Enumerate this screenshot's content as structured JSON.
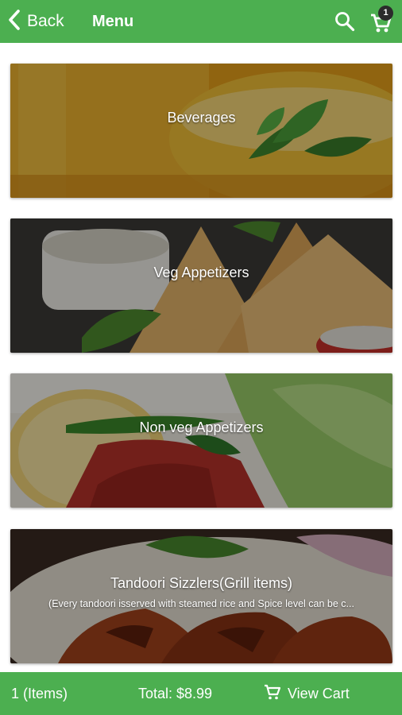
{
  "header": {
    "back_label": "Back",
    "title": "Menu",
    "cart_count": "1"
  },
  "categories": [
    {
      "label": "Beverages",
      "subtitle": ""
    },
    {
      "label": "Veg Appetizers",
      "subtitle": ""
    },
    {
      "label": "Non veg Appetizers",
      "subtitle": ""
    },
    {
      "label": "Tandoori Sizzlers(Grill items)",
      "subtitle": "(Every tandoori isserved with steamed rice and Spice level can be c..."
    }
  ],
  "footer": {
    "items": "1 (Items)",
    "total": "Total: $8.99",
    "view_cart": "View Cart"
  },
  "colors": {
    "accent": "#4caf50",
    "badge": "#2b2b2b"
  },
  "icons": [
    "chevron-left-icon",
    "search-icon",
    "cart-icon"
  ]
}
